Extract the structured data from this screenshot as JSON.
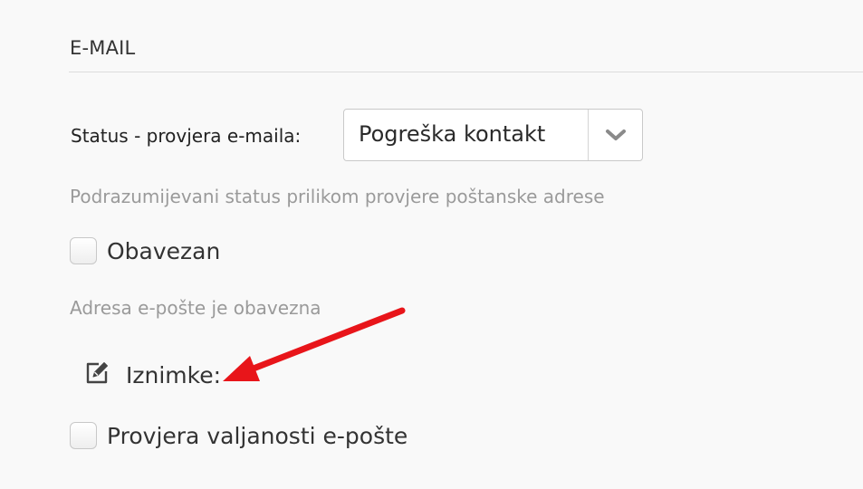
{
  "section": {
    "title": "E-MAIL"
  },
  "status_field": {
    "label": "Status - provjera e-maila:",
    "selected_value": "Pogreška kontakt",
    "hint": "Podrazumijevani status prilikom provjere poštanske adrese"
  },
  "required_checkbox": {
    "label": "Obavezan",
    "checked": false,
    "hint": "Adresa e-pošte je obavezna"
  },
  "exceptions": {
    "label": "Iznimke:",
    "icon": "edit-icon"
  },
  "validity_checkbox": {
    "label": "Provjera valjanosti e-pošte",
    "checked": false
  },
  "annotation": {
    "arrow_color": "#e8151a"
  }
}
